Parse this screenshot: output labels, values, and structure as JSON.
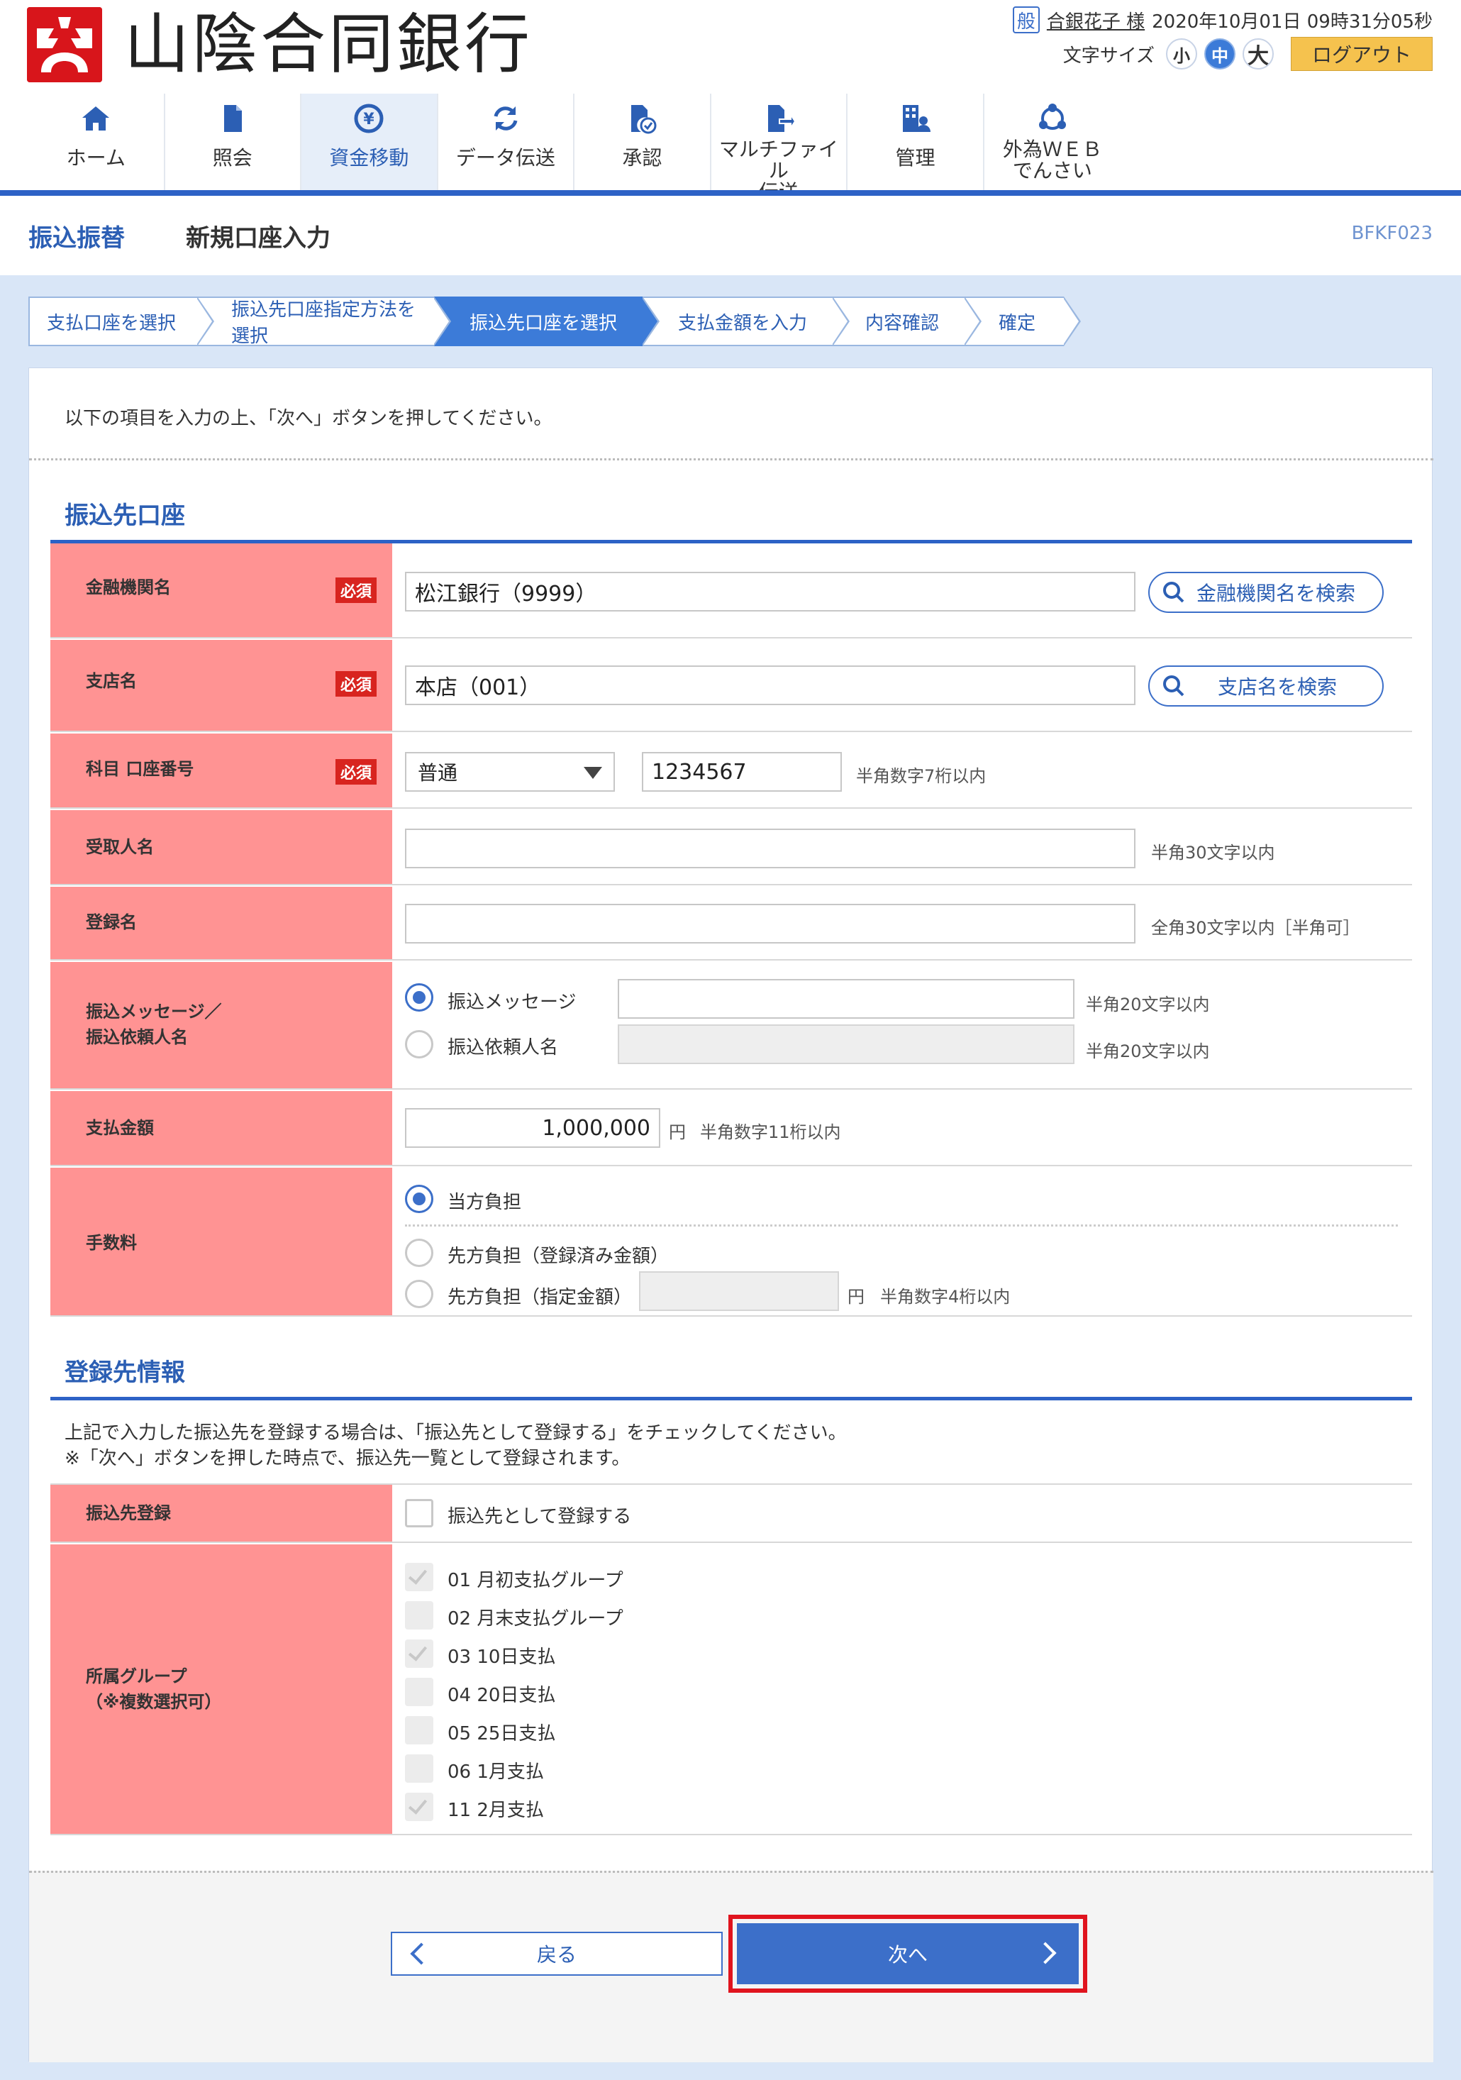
{
  "header": {
    "user_badge": "般",
    "user_name": "合銀花子 様",
    "datetime": "2020年10月01日 09時31分05秒",
    "font_size_label": "文字サイズ",
    "font_sizes": [
      "小",
      "中",
      "大"
    ],
    "font_size_selected": "中",
    "logout_label": "ログアウト"
  },
  "global_nav": [
    {
      "label": "ホーム",
      "icon": "home-icon"
    },
    {
      "label": "照会",
      "icon": "document-icon"
    },
    {
      "label": "資金移動",
      "icon": "yen-transfer-icon",
      "active": true
    },
    {
      "label": "データ伝送",
      "icon": "refresh-icon"
    },
    {
      "label": "承認",
      "icon": "approve-document-icon"
    },
    {
      "label": "マルチファイル\n伝送",
      "icon": "file-send-icon"
    },
    {
      "label": "管理",
      "icon": "building-user-icon"
    },
    {
      "label": "外為ＷＥＢ\nでんさい",
      "icon": "network-icon"
    }
  ],
  "page": {
    "category": "振込振替",
    "title": "新規口座入力",
    "screen_id": "BFKF023"
  },
  "steps": [
    {
      "label": "支払口座を選択"
    },
    {
      "label": "振込先口座指定方法を選択"
    },
    {
      "label": "振込先口座を選択",
      "active": true
    },
    {
      "label": "支払金額を入力"
    },
    {
      "label": "内容確認"
    },
    {
      "label": "確定"
    }
  ],
  "intro": "以下の項目を入力の上、「次へ」ボタンを押してください。",
  "required_label": "必須",
  "section1": {
    "title": "振込先口座",
    "bank": {
      "label": "金融機関名",
      "value": "松江銀行（9999）",
      "search_label": "金融機関名を検索"
    },
    "branch": {
      "label": "支店名",
      "value": "本店（001）",
      "search_label": "支店名を検索"
    },
    "account": {
      "label": "科目 口座番号",
      "type_value": "普通",
      "number_value": "1234567",
      "hint": "半角数字7桁以内"
    },
    "recipient": {
      "label": "受取人名",
      "value": "",
      "hint": "半角30文字以内"
    },
    "register_name": {
      "label": "登録名",
      "value": "",
      "hint": "全角30文字以内［半角可］"
    },
    "message": {
      "label": "振込メッセージ／\n振込依頼人名",
      "option1": "振込メッセージ",
      "option2": "振込依頼人名",
      "selected": "振込メッセージ",
      "hint1": "半角20文字以内",
      "hint2": "半角20文字以内"
    },
    "amount": {
      "label": "支払金額",
      "value": "1,000,000",
      "unit": "円",
      "hint": "半角数字11桁以内"
    },
    "fee": {
      "label": "手数料",
      "option1": "当方負担",
      "option2": "先方負担（登録済み金額）",
      "option3": "先方負担（指定金額）",
      "selected": "当方負担",
      "unit": "円",
      "hint": "半角数字4桁以内"
    }
  },
  "section2": {
    "title": "登録先情報",
    "desc1": "上記で入力した振込先を登録する場合は、「振込先として登録する」をチェックしてください。",
    "desc2": "※「次へ」ボタンを押した時点で、振込先一覧として登録されます。",
    "register": {
      "label": "振込先登録",
      "checkbox_label": "振込先として登録する",
      "checked": false
    },
    "groups": {
      "label": "所属グループ\n（※複数選択可）",
      "items": [
        {
          "label": "01 月初支払グループ",
          "checked": true
        },
        {
          "label": "02 月末支払グループ",
          "checked": false
        },
        {
          "label": "03 10日支払",
          "checked": true
        },
        {
          "label": "04 20日支払",
          "checked": false
        },
        {
          "label": "05 25日支払",
          "checked": false
        },
        {
          "label": "06 1月支払",
          "checked": false
        },
        {
          "label": "11 2月支払",
          "checked": true
        }
      ]
    }
  },
  "buttons": {
    "back": "戻る",
    "next": "次へ"
  },
  "colors": {
    "primary": "#2d62c6",
    "label_bg": "#ff9393",
    "required": "#d8241f",
    "highlight": "#e0141e",
    "logout": "#f5c24e"
  }
}
